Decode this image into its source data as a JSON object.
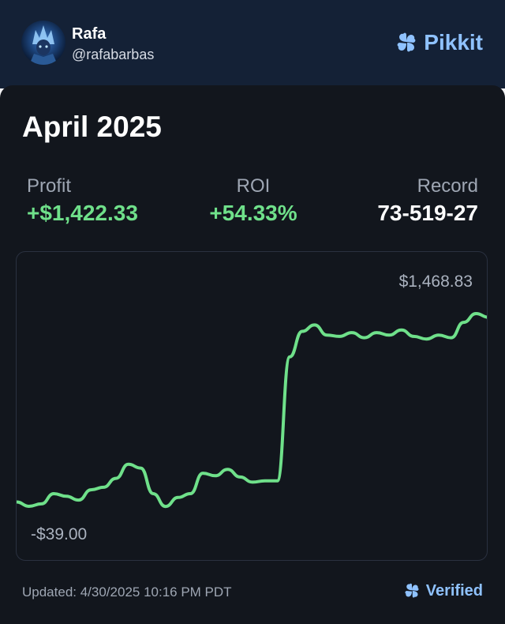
{
  "user": {
    "name": "Rafa",
    "handle": "@rafabarbas",
    "avatar_icon": "user-avatar"
  },
  "brand": {
    "name": "Pikkit",
    "icon": "clover-icon",
    "color": "#8fc2ff"
  },
  "summary": {
    "month": "April 2025",
    "profit": {
      "label": "Profit",
      "value": "+$1,422.33"
    },
    "roi": {
      "label": "ROI",
      "value": "+54.33%"
    },
    "record": {
      "label": "Record",
      "value": "73-519-27"
    }
  },
  "chart": {
    "max_label": "$1,468.83",
    "min_label": "-$39.00",
    "line_color": "#6fe08a"
  },
  "chart_data": {
    "type": "line",
    "title": "",
    "xlabel": "",
    "ylabel": "",
    "ylim": [
      -39.0,
      1468.83
    ],
    "series": [
      {
        "values": [
          -5,
          -39,
          -20,
          60,
          40,
          10,
          90,
          110,
          180,
          290,
          260,
          60,
          -40,
          30,
          60,
          220,
          200,
          250,
          190,
          150,
          160,
          160,
          1130,
          1330,
          1380,
          1300,
          1290,
          1320,
          1280,
          1320,
          1300,
          1340,
          1290,
          1270,
          1300,
          1280,
          1400,
          1468.83,
          1440
        ]
      }
    ]
  },
  "footer": {
    "updated": "Updated: 4/30/2025 10:16 PM PDT",
    "verified": "Verified",
    "verified_icon": "clover-icon"
  }
}
